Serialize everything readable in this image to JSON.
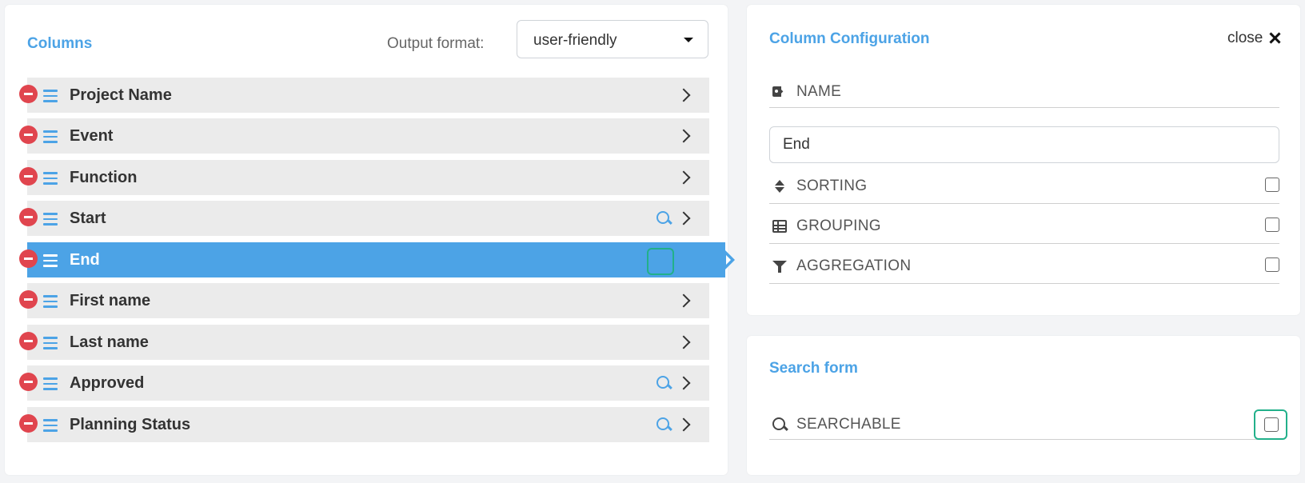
{
  "columns_panel": {
    "title": "Columns",
    "output_format_label": "Output format:",
    "output_format_value": "user-friendly",
    "items": [
      {
        "label": "Project Name",
        "searchable": false,
        "selected": false
      },
      {
        "label": "Event",
        "searchable": false,
        "selected": false
      },
      {
        "label": "Function",
        "searchable": false,
        "selected": false
      },
      {
        "label": "Start",
        "searchable": true,
        "selected": false
      },
      {
        "label": "End",
        "searchable": false,
        "selected": true
      },
      {
        "label": "First name",
        "searchable": false,
        "selected": false
      },
      {
        "label": "Last name",
        "searchable": false,
        "selected": false
      },
      {
        "label": "Approved",
        "searchable": true,
        "selected": false
      },
      {
        "label": "Planning Status",
        "searchable": true,
        "selected": false
      }
    ]
  },
  "config_panel": {
    "title": "Column Configuration",
    "close_label": "close",
    "name_label": "NAME",
    "name_value": "End",
    "sorting_label": "SORTING",
    "grouping_label": "GROUPING",
    "aggregation_label": "AGGREGATION",
    "sorting_checked": false,
    "grouping_checked": false,
    "aggregation_checked": false
  },
  "search_panel": {
    "title": "Search form",
    "searchable_label": "SEARCHABLE",
    "searchable_checked": false
  },
  "colors": {
    "accent": "#4ca3e6",
    "remove": "#e0454e",
    "focus": "#22b08a"
  }
}
